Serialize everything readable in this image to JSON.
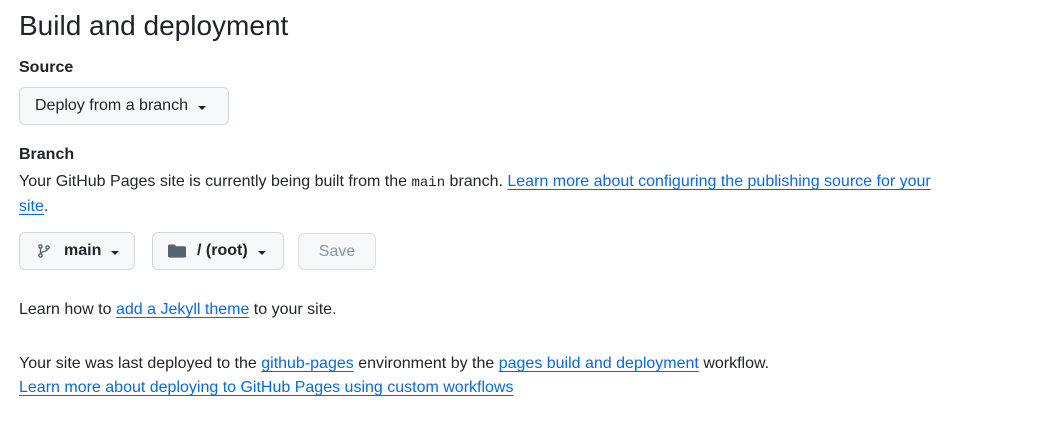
{
  "section": {
    "title": "Build and deployment"
  },
  "source": {
    "label": "Source",
    "dropdown_value": "Deploy from a branch"
  },
  "branch": {
    "label": "Branch",
    "desc_before": "Your GitHub Pages site is currently being built from the ",
    "desc_code": "main",
    "desc_after": " branch. ",
    "desc_link": "Learn more about configuring the publishing source for your site",
    "desc_end": ".",
    "branch_select": "main",
    "folder_select": "/ (root)",
    "save_label": "Save",
    "icons": {
      "branch": "git-branch-icon",
      "folder": "folder-icon"
    }
  },
  "jekyll": {
    "before": "Learn how to ",
    "link": "add a Jekyll theme",
    "after": " to your site."
  },
  "deployment": {
    "before": "Your site was last deployed to the ",
    "environment_link": "github-pages",
    "middle": " environment by the ",
    "workflow_link": "pages build and deployment",
    "after": " workflow.",
    "custom_workflows_link": "Learn more about deploying to GitHub Pages using custom workflows"
  },
  "colors": {
    "link": "#0969da",
    "text": "#1f2328",
    "button_bg": "#f6f8fa",
    "button_border": "#d0d7de",
    "disabled_text": "#8c959f"
  }
}
